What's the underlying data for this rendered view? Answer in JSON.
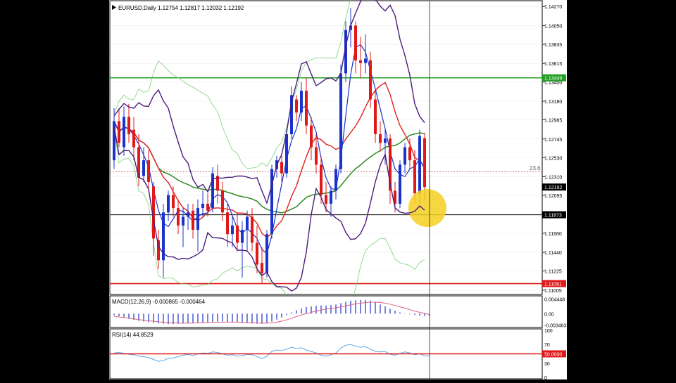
{
  "chart_data": {
    "type": "candlestick",
    "symbol_header": "EURUSD,Daily  1.12754 1.12817 1.12032 1.12192",
    "price_axis_ticks": [
      "1.14270",
      "1.14050",
      "1.13835",
      "1.13615",
      "1.13400",
      "1.13180",
      "1.12965",
      "1.12745",
      "1.12530",
      "1.12310",
      "1.12095",
      "1.11880",
      "1.11660",
      "1.11440",
      "1.11225",
      "1.11005"
    ],
    "price_range": [
      1.1098,
      1.1428
    ],
    "price_labels": [
      {
        "name": "green-level",
        "text": "1.13449",
        "value": 1.13449,
        "color": "#22a022"
      },
      {
        "name": "current",
        "text": "1.12192",
        "value": 1.12192,
        "color": "#000000"
      },
      {
        "name": "black-level",
        "text": "1.11873",
        "value": 1.11873,
        "color": "#000000"
      },
      {
        "name": "red-level",
        "text": "1.11081",
        "value": 1.11081,
        "color": "#e01818"
      }
    ],
    "fib_label": "23.6",
    "fib_value": 1.1237,
    "candles": [
      {
        "o": 1.125,
        "h": 1.131,
        "l": 1.124,
        "c": 1.1295,
        "bull": true
      },
      {
        "o": 1.1295,
        "h": 1.131,
        "l": 1.1265,
        "c": 1.127,
        "bull": false
      },
      {
        "o": 1.1265,
        "h": 1.1312,
        "l": 1.1255,
        "c": 1.13,
        "bull": true
      },
      {
        "o": 1.13,
        "h": 1.1315,
        "l": 1.127,
        "c": 1.128,
        "bull": false
      },
      {
        "o": 1.1285,
        "h": 1.13,
        "l": 1.125,
        "c": 1.1265,
        "bull": false
      },
      {
        "o": 1.1265,
        "h": 1.128,
        "l": 1.122,
        "c": 1.123,
        "bull": false
      },
      {
        "o": 1.1232,
        "h": 1.1265,
        "l": 1.1225,
        "c": 1.125,
        "bull": true
      },
      {
        "o": 1.125,
        "h": 1.1262,
        "l": 1.1215,
        "c": 1.1225,
        "bull": false
      },
      {
        "o": 1.122,
        "h": 1.1225,
        "l": 1.114,
        "c": 1.116,
        "bull": false
      },
      {
        "o": 1.1158,
        "h": 1.117,
        "l": 1.1125,
        "c": 1.1135,
        "bull": false
      },
      {
        "o": 1.1135,
        "h": 1.12,
        "l": 1.1115,
        "c": 1.119,
        "bull": true
      },
      {
        "o": 1.119,
        "h": 1.1215,
        "l": 1.118,
        "c": 1.121,
        "bull": true
      },
      {
        "o": 1.121,
        "h": 1.122,
        "l": 1.1185,
        "c": 1.1195,
        "bull": false
      },
      {
        "o": 1.1195,
        "h": 1.1205,
        "l": 1.1165,
        "c": 1.1175,
        "bull": false
      },
      {
        "o": 1.1175,
        "h": 1.1195,
        "l": 1.115,
        "c": 1.1185,
        "bull": true
      },
      {
        "o": 1.1185,
        "h": 1.12,
        "l": 1.117,
        "c": 1.119,
        "bull": true
      },
      {
        "o": 1.1192,
        "h": 1.12,
        "l": 1.116,
        "c": 1.117,
        "bull": false
      },
      {
        "o": 1.117,
        "h": 1.1205,
        "l": 1.1145,
        "c": 1.1195,
        "bull": true
      },
      {
        "o": 1.1195,
        "h": 1.1215,
        "l": 1.1185,
        "c": 1.12,
        "bull": true
      },
      {
        "o": 1.12,
        "h": 1.1212,
        "l": 1.1185,
        "c": 1.1192,
        "bull": false
      },
      {
        "o": 1.1195,
        "h": 1.1242,
        "l": 1.119,
        "c": 1.1235,
        "bull": true
      },
      {
        "o": 1.1232,
        "h": 1.1245,
        "l": 1.12,
        "c": 1.1215,
        "bull": false
      },
      {
        "o": 1.1215,
        "h": 1.1225,
        "l": 1.118,
        "c": 1.119,
        "bull": false
      },
      {
        "o": 1.119,
        "h": 1.12,
        "l": 1.115,
        "c": 1.1165,
        "bull": false
      },
      {
        "o": 1.1165,
        "h": 1.1185,
        "l": 1.115,
        "c": 1.1175,
        "bull": true
      },
      {
        "o": 1.1175,
        "h": 1.119,
        "l": 1.1145,
        "c": 1.1155,
        "bull": false
      },
      {
        "o": 1.1155,
        "h": 1.118,
        "l": 1.1115,
        "c": 1.117,
        "bull": true
      },
      {
        "o": 1.117,
        "h": 1.1192,
        "l": 1.1145,
        "c": 1.1185,
        "bull": true
      },
      {
        "o": 1.1185,
        "h": 1.1195,
        "l": 1.1145,
        "c": 1.1155,
        "bull": false
      },
      {
        "o": 1.1155,
        "h": 1.1175,
        "l": 1.112,
        "c": 1.113,
        "bull": false
      },
      {
        "o": 1.1132,
        "h": 1.115,
        "l": 1.1108,
        "c": 1.112,
        "bull": false
      },
      {
        "o": 1.112,
        "h": 1.117,
        "l": 1.1115,
        "c": 1.1165,
        "bull": true
      },
      {
        "o": 1.1165,
        "h": 1.1245,
        "l": 1.116,
        "c": 1.124,
        "bull": true
      },
      {
        "o": 1.124,
        "h": 1.1255,
        "l": 1.123,
        "c": 1.125,
        "bull": true
      },
      {
        "o": 1.1248,
        "h": 1.1255,
        "l": 1.1225,
        "c": 1.1235,
        "bull": false
      },
      {
        "o": 1.1235,
        "h": 1.1285,
        "l": 1.123,
        "c": 1.128,
        "bull": true
      },
      {
        "o": 1.128,
        "h": 1.1335,
        "l": 1.1275,
        "c": 1.1325,
        "bull": true
      },
      {
        "o": 1.132,
        "h": 1.1325,
        "l": 1.1295,
        "c": 1.1305,
        "bull": false
      },
      {
        "o": 1.1305,
        "h": 1.134,
        "l": 1.1295,
        "c": 1.133,
        "bull": true
      },
      {
        "o": 1.133,
        "h": 1.1345,
        "l": 1.128,
        "c": 1.129,
        "bull": false
      },
      {
        "o": 1.129,
        "h": 1.13,
        "l": 1.125,
        "c": 1.1265,
        "bull": false
      },
      {
        "o": 1.1265,
        "h": 1.128,
        "l": 1.1235,
        "c": 1.1245,
        "bull": false
      },
      {
        "o": 1.1245,
        "h": 1.1255,
        "l": 1.12,
        "c": 1.121,
        "bull": false
      },
      {
        "o": 1.121,
        "h": 1.1225,
        "l": 1.119,
        "c": 1.12,
        "bull": false
      },
      {
        "o": 1.12,
        "h": 1.122,
        "l": 1.1185,
        "c": 1.1215,
        "bull": true
      },
      {
        "o": 1.1215,
        "h": 1.1245,
        "l": 1.1205,
        "c": 1.124,
        "bull": true
      },
      {
        "o": 1.124,
        "h": 1.136,
        "l": 1.1235,
        "c": 1.135,
        "bull": true
      },
      {
        "o": 1.135,
        "h": 1.141,
        "l": 1.134,
        "c": 1.14,
        "bull": true
      },
      {
        "o": 1.14,
        "h": 1.1425,
        "l": 1.138,
        "c": 1.1405,
        "bull": true
      },
      {
        "o": 1.1405,
        "h": 1.141,
        "l": 1.135,
        "c": 1.1365,
        "bull": false
      },
      {
        "o": 1.1365,
        "h": 1.1392,
        "l": 1.1345,
        "c": 1.1362,
        "bull": false
      },
      {
        "o": 1.1362,
        "h": 1.1395,
        "l": 1.135,
        "c": 1.1367,
        "bull": true
      },
      {
        "o": 1.1365,
        "h": 1.1375,
        "l": 1.131,
        "c": 1.132,
        "bull": false
      },
      {
        "o": 1.132,
        "h": 1.133,
        "l": 1.127,
        "c": 1.128,
        "bull": false
      },
      {
        "o": 1.128,
        "h": 1.1295,
        "l": 1.126,
        "c": 1.127,
        "bull": false
      },
      {
        "o": 1.127,
        "h": 1.1285,
        "l": 1.1245,
        "c": 1.1275,
        "bull": true
      },
      {
        "o": 1.1275,
        "h": 1.128,
        "l": 1.12,
        "c": 1.1215,
        "bull": false
      },
      {
        "o": 1.1215,
        "h": 1.1225,
        "l": 1.119,
        "c": 1.12,
        "bull": false
      },
      {
        "o": 1.12,
        "h": 1.125,
        "l": 1.1195,
        "c": 1.1245,
        "bull": true
      },
      {
        "o": 1.1245,
        "h": 1.127,
        "l": 1.1235,
        "c": 1.1265,
        "bull": true
      },
      {
        "o": 1.1265,
        "h": 1.1275,
        "l": 1.124,
        "c": 1.125,
        "bull": false
      },
      {
        "o": 1.125,
        "h": 1.1262,
        "l": 1.12,
        "c": 1.1212,
        "bull": false
      },
      {
        "o": 1.1212,
        "h": 1.1285,
        "l": 1.12,
        "c": 1.1278,
        "bull": true
      },
      {
        "o": 1.12754,
        "h": 1.12817,
        "l": 1.12032,
        "c": 1.12192,
        "bull": false
      }
    ],
    "macd": {
      "label": "MACD(12,26,9) -0.000865 -0.000464",
      "ticks": [
        "0.004448",
        "0.00",
        "-0.003463"
      ],
      "range": [
        -0.0038,
        0.0048
      ],
      "histogram": [
        -0.0005,
        -0.0008,
        -0.0012,
        -0.0016,
        -0.0019,
        -0.0022,
        -0.0024,
        -0.0026,
        -0.0028,
        -0.003,
        -0.0031,
        -0.0032,
        -0.0032,
        -0.0031,
        -0.003,
        -0.0029,
        -0.0029,
        -0.0028,
        -0.0027,
        -0.0026,
        -0.0025,
        -0.0024,
        -0.0024,
        -0.0025,
        -0.0026,
        -0.0027,
        -0.0028,
        -0.0029,
        -0.003,
        -0.0031,
        -0.0031,
        -0.0029,
        -0.0024,
        -0.0018,
        -0.0012,
        -0.0004,
        0.0004,
        0.001,
        0.0016,
        0.002,
        0.0022,
        0.0024,
        0.0025,
        0.0025,
        0.0026,
        0.0028,
        0.0032,
        0.0036,
        0.004,
        0.0041,
        0.0042,
        0.0042,
        0.004,
        0.0035,
        0.0028,
        0.0022,
        0.0015,
        0.0009,
        0.0004,
        0.0001,
        -0.0002,
        -0.0004,
        -0.0006,
        -0.0007,
        -0.0008
      ],
      "signal": [
        -0.0008,
        -0.001,
        -0.0012,
        -0.0014,
        -0.0016,
        -0.0018,
        -0.002,
        -0.0022,
        -0.0023,
        -0.0025,
        -0.0026,
        -0.0027,
        -0.0028,
        -0.0029,
        -0.0029,
        -0.0029,
        -0.0029,
        -0.0028,
        -0.0028,
        -0.0027,
        -0.0027,
        -0.0026,
        -0.0026,
        -0.0026,
        -0.0026,
        -0.0026,
        -0.0027,
        -0.0027,
        -0.0028,
        -0.0028,
        -0.0029,
        -0.0029,
        -0.0028,
        -0.0026,
        -0.0023,
        -0.0019,
        -0.0014,
        -0.0009,
        -0.0004,
        0.0,
        0.0004,
        0.0008,
        0.0011,
        0.0014,
        0.0016,
        0.0018,
        0.0021,
        0.0024,
        0.0027,
        0.003,
        0.0032,
        0.0034,
        0.0035,
        0.0035,
        0.0034,
        0.0032,
        0.0029,
        0.0025,
        0.0021,
        0.0017,
        0.0012,
        0.0008,
        0.0004,
        0.0001,
        -0.0003
      ]
    },
    "rsi": {
      "label": "RSI(14) 44.8529",
      "ticks": [
        "100",
        "70",
        "30",
        "0"
      ],
      "tick_values": [
        100,
        70,
        30,
        0
      ],
      "range": [
        0,
        100
      ],
      "level": 50,
      "level_label": "50.0000",
      "values": [
        52,
        53,
        51,
        49,
        48,
        45,
        44,
        42,
        38,
        34,
        36,
        40,
        41,
        44,
        47,
        49,
        46,
        50,
        52,
        51,
        54,
        53,
        50,
        47,
        48,
        45,
        46,
        49,
        48,
        44,
        40,
        45,
        55,
        58,
        57,
        60,
        64,
        61,
        63,
        58,
        55,
        52,
        47,
        45,
        48,
        52,
        62,
        68,
        70,
        66,
        64,
        65,
        60,
        55,
        54,
        55,
        49,
        47,
        51,
        54,
        52,
        48,
        50,
        46,
        45
      ]
    },
    "colors": {
      "bull": "#1a33cc",
      "bear": "#e01818",
      "bollinger_outer": "#7ad07a",
      "envelope": "#4a1c7c",
      "ma_slow": "#2e8b22",
      "ma_fast": "#e02020",
      "ma_blue": "#1a33cc",
      "rsi_line": "#5aa8e8",
      "macd_signal": "#e06080",
      "highlight": "#f4d020",
      "green_level": "#22a022",
      "red_level": "#e01818"
    }
  }
}
